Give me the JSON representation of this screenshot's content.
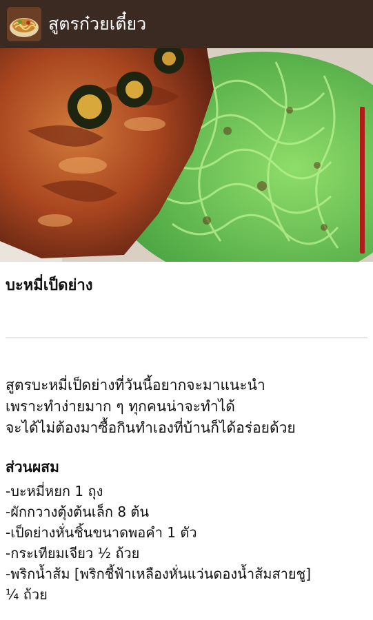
{
  "appbar": {
    "title": "สูตรก๋วยเตี๋ยว",
    "icon": "noodle-bowl-icon",
    "background": "#3a2a22"
  },
  "recipe": {
    "title": "บะหมี่เป็ดย่าง",
    "intro_lines": [
      "สูตรบะหมี่เป็ดย่างที่วันนี้อยากจะมาแนะนำ",
      "เพราะทำง่ายมาก ๆ ทุกคนน่าจะทำได้",
      "จะได้ไม่ต้องมาซื้อกินทำเองที่บ้านก็ได้อร่อยด้วย"
    ],
    "ingredients_heading": "ส่วนผสม",
    "ingredients": [
      "-บะหมี่หยก 1 ถุง",
      "-ผักกวางตุ้งต้นเล็ก 8 ต้น",
      "-เป็ดย่างหั่นชิ้นขนาดพอคำ 1 ตัว",
      "-กระเทียมเจียว ½ ถ้วย",
      "-พริกน้ำส้ม [พริกชี้ฟ้าเหลืองหั่นแว่นดองน้ำส้มสายชู]",
      "¼ ถ้วย"
    ]
  },
  "colors": {
    "scrollbar": "#b01b1b",
    "divider": "#c6c6c6"
  }
}
